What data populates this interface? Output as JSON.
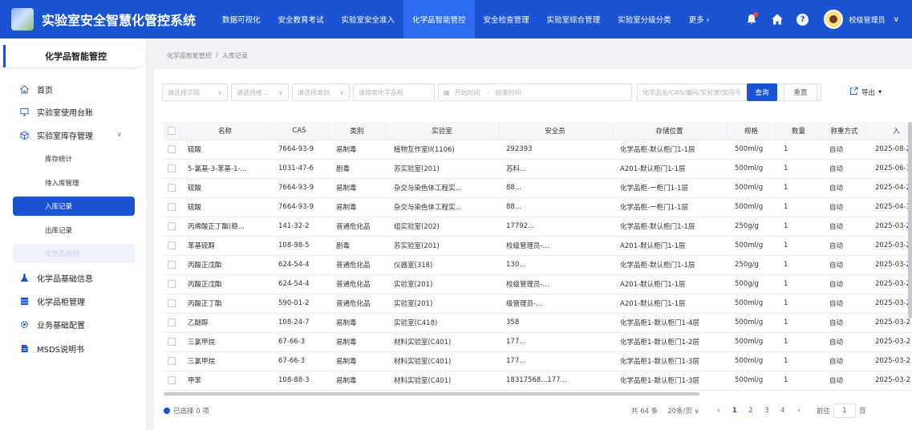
{
  "app": {
    "title": "实验室安全智慧化管控系统"
  },
  "topnav": [
    {
      "label": "数据可视化"
    },
    {
      "label": "安全教育考试"
    },
    {
      "label": "实验室安全准入"
    },
    {
      "label": "化学品智能管控"
    },
    {
      "label": "安全检查管理"
    },
    {
      "label": "实验室综合管理"
    },
    {
      "label": "实验室分级分类"
    },
    {
      "label": "更多 ›"
    }
  ],
  "user": {
    "name": "校级管理员",
    "caret": "∨"
  },
  "sidebar": {
    "header": "化学品智能管控",
    "items": [
      {
        "label": "首页"
      },
      {
        "label": "实验室使用台账"
      },
      {
        "label": "实验室库存管理"
      },
      {
        "label": "化学品基础信息"
      },
      {
        "label": "化学品柜管理"
      },
      {
        "label": "业务基础配置"
      },
      {
        "label": "MSDS说明书"
      }
    ],
    "subitems": [
      {
        "label": "库存统计"
      },
      {
        "label": "待入库管理"
      },
      {
        "label": "入库记录"
      },
      {
        "label": "出库记录"
      },
      {
        "label": "化学品申领"
      }
    ],
    "caret": "∨"
  },
  "breadcrumb": {
    "root": "化学品智能管控",
    "sep": "/",
    "current": "入库记录"
  },
  "filters": {
    "college": "请选择学院",
    "building": "请选择楼...",
    "category": "请选择类别",
    "cabinet": "请搜索化学品柜",
    "start": "开始时间",
    "range_sep": "-",
    "end": "结束时间",
    "keyword": "化学品名/CAS/编码/实验室/房间号"
  },
  "buttons": {
    "query": "查询",
    "reset": "重置",
    "export": "导出"
  },
  "table": {
    "headers": [
      "名称",
      "CAS",
      "类别",
      "实验室",
      "安全员",
      "存储位置",
      "规格",
      "数量",
      "称重方式",
      "入"
    ],
    "rows": [
      {
        "name": "硫酸",
        "cas": "7664-93-9",
        "cat": "易制毒",
        "lab": "植物互作室II(1106)",
        "safety": "292393",
        "loc": "化学品柜-默认柜门1-1层",
        "spec": "500ml/g",
        "qty": "1",
        "weigh": "自动",
        "date": "2025-08-2"
      },
      {
        "name": "5-氯基-3-苯基-1-...",
        "cas": "1031-47-6",
        "cat": "剧毒",
        "lab": "苏实验室(201)",
        "safety": "苏科...",
        "loc": "A201-默认柜门1-1层",
        "spec": "500ml/g",
        "qty": "1",
        "weigh": "自动",
        "date": "2025-06-1"
      },
      {
        "name": "硫酸",
        "cas": "7664-93-9",
        "cat": "易制毒",
        "lab": "杂交与染色体工程实...",
        "safety": "88...",
        "loc": "化学品柜-一柜门1-1层",
        "spec": "500ml/g",
        "qty": "1",
        "weigh": "自动",
        "date": "2025-04-2"
      },
      {
        "name": "硫酸",
        "cas": "7664-93-9",
        "cat": "易制毒",
        "lab": "杂交与染色体工程实...",
        "safety": "88...",
        "loc": "化学品柜-一柜门1-1层",
        "spec": "500ml/g",
        "qty": "1",
        "weigh": "自动",
        "date": "2025-04-1"
      },
      {
        "name": "丙烯酸正丁酯(稳...",
        "cas": "141-32-2",
        "cat": "普通危化品",
        "lab": "组实验室(202)",
        "safety": "17792...",
        "loc": "化学品柜-默认柜门1-1层",
        "spec": "250g/g",
        "qty": "1",
        "weigh": "自动",
        "date": "2025-03-2"
      },
      {
        "name": "苯基硫醇",
        "cas": "108-98-5",
        "cat": "剧毒",
        "lab": "苏实验室(201)",
        "safety": "校级管理员-...",
        "loc": "A201-默认柜门1-1层",
        "spec": "500ml/g",
        "qty": "1",
        "weigh": "自动",
        "date": "2025-03-2"
      },
      {
        "name": "丙酸正戊酯",
        "cas": "624-54-4",
        "cat": "普通危化品",
        "lab": "仪器室(318)",
        "safety": "130...",
        "loc": "化学品柜-默认柜门1-1层",
        "spec": "250g/g",
        "qty": "1",
        "weigh": "自动",
        "date": "2025-03-2"
      },
      {
        "name": "丙酸正戊酯",
        "cas": "624-54-4",
        "cat": "普通危化品",
        "lab": "实验室(201)",
        "safety": "校级管理员-...",
        "loc": "A201-默认柜门1-1层",
        "spec": "500g/g",
        "qty": "1",
        "weigh": "自动",
        "date": "2025-03-2"
      },
      {
        "name": "丙酸正丁酯",
        "cas": "590-01-2",
        "cat": "普通危化品",
        "lab": "实验室(201)",
        "safety": "级管理员-...",
        "loc": "A201-默认柜门1-1层",
        "spec": "500ml/g",
        "qty": "1",
        "weigh": "自动",
        "date": "2025-03-2"
      },
      {
        "name": "乙醚醇",
        "cas": "108-24-7",
        "cat": "易制毒",
        "lab": "实验室(C418)",
        "safety": "358",
        "loc": "化学品柜1-默认柜门1-4层",
        "spec": "500ml/g",
        "qty": "1",
        "weigh": "自动",
        "date": "2025-03-2"
      },
      {
        "name": "三氯甲烷",
        "cas": "67-66-3",
        "cat": "易制毒",
        "lab": "材料实验室(C401)",
        "safety": "177...",
        "loc": "化学品柜1-默认柜门1-2层",
        "spec": "500ml/g",
        "qty": "1",
        "weigh": "自动",
        "date": "2025-03-2"
      },
      {
        "name": "三氯甲烷",
        "cas": "67-66-3",
        "cat": "易制毒",
        "lab": "材料实验室(C401)",
        "safety": "177...",
        "loc": "化学品柜1-默认柜门1-3层",
        "spec": "500ml/g",
        "qty": "1",
        "weigh": "自动",
        "date": "2025-03-2"
      },
      {
        "name": "甲苯",
        "cas": "108-88-3",
        "cat": "易制毒",
        "lab": "材料实验室(C401)",
        "safety": "18317568...177...",
        "loc": "化学品柜1-默认柜门1-3层",
        "spec": "500ml/g",
        "qty": "1",
        "weigh": "自动",
        "date": "2025-03-2"
      }
    ]
  },
  "footer": {
    "selected": "已选择 0 项"
  },
  "pagination": {
    "total": "共 64 条",
    "page_size": "20条/页",
    "pages": [
      "1",
      "2",
      "3",
      "4"
    ],
    "current": "1",
    "goto_label": "前往",
    "goto_value": "1",
    "goto_unit": "页",
    "prev": "‹",
    "next": "›"
  },
  "colors": {
    "primary": "#1b54d3",
    "active_tab": "#2d6cf0",
    "bell_badge": "#f24c4c"
  }
}
